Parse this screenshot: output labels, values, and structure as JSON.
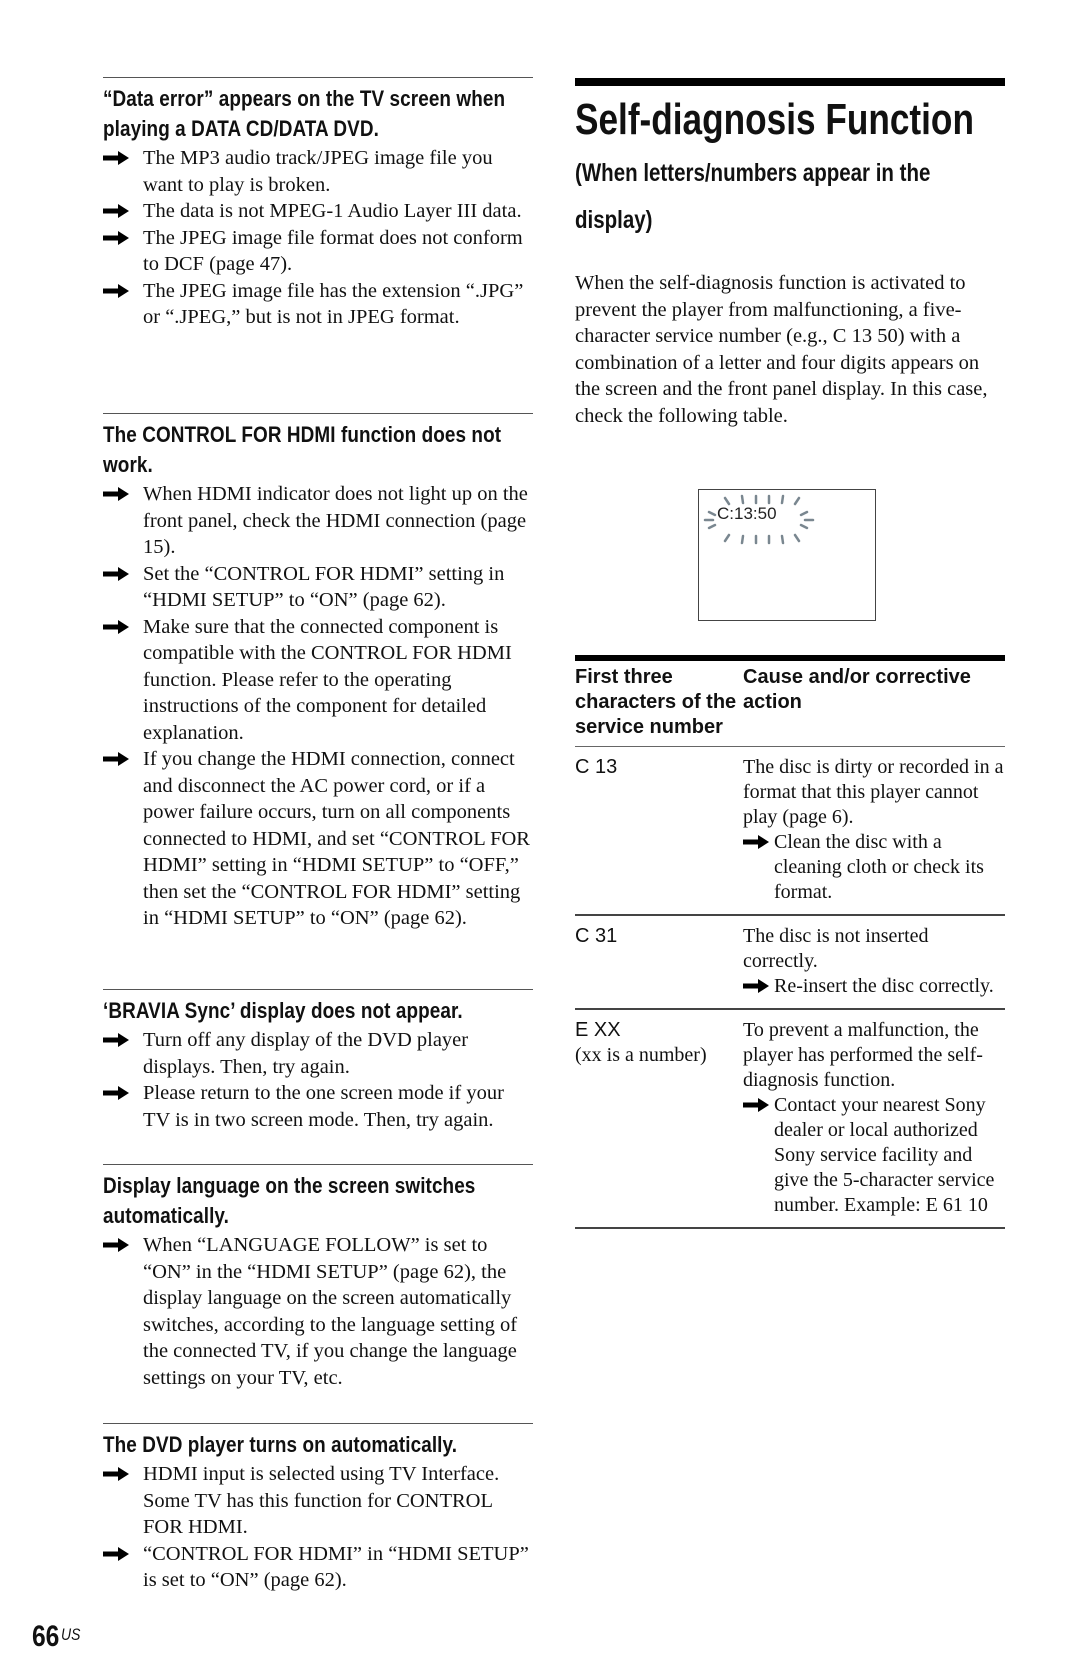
{
  "left_column": {
    "sections": [
      {
        "title": "“Data error” appears on the TV screen when playing a DATA CD/DATA DVD.",
        "bullets": [
          "The MP3 audio track/JPEG image file you want to play is broken.",
          "The data is not MPEG-1 Audio Layer III data.",
          "The JPEG image file format does not conform to DCF (page 47).",
          "The JPEG image file has the extension “.JPG” or “.JPEG,” but is not in JPEG format."
        ]
      },
      {
        "title": "The CONTROL FOR HDMI function does not work.",
        "bullets": [
          "When HDMI indicator does not light up on the front panel, check the HDMI connection (page 15).",
          "Set the “CONTROL FOR HDMI” setting in “HDMI SETUP” to “ON” (page 62).",
          "Make sure that the connected component is compatible with the CONTROL FOR HDMI function. Please refer to the operating instructions of the component for detailed explanation.",
          "If you change the HDMI connection, connect and disconnect the AC power cord, or if a power failure occurs, turn on all components connected to HDMI, and set “CONTROL FOR HDMI” setting in “HDMI SETUP” to “OFF,” then set the “CONTROL FOR HDMI” setting in “HDMI SETUP” to “ON” (page 62)."
        ]
      },
      {
        "title": "‘BRAVIA Sync’ display does not appear.",
        "bullets": [
          "Turn off any display of the DVD player displays. Then, try again.",
          "Please return to the one screen mode if your TV is in two screen mode. Then, try again."
        ]
      },
      {
        "title": "Display language on the screen switches automatically.",
        "bullets": [
          "When “LANGUAGE FOLLOW” is set to “ON” in the “HDMI SETUP” (page 62), the display language on the screen automatically switches, according to the language setting of the connected TV, if you change the language settings on your TV, etc."
        ]
      },
      {
        "title": "The DVD player turns on automatically.",
        "bullets": [
          "HDMI input is selected using TV Interface. Some TV has this function for CONTROL FOR HDMI.",
          "“CONTROL FOR HDMI” in “HDMI SETUP” is set to “ON” (page 62)."
        ]
      }
    ]
  },
  "right_column": {
    "title": "Self-diagnosis Function",
    "subtitle": "(When letters/numbers appear in the display)",
    "intro": "When the self-diagnosis function is activated to prevent the player from malfunctioning, a five-character service number (e.g., C 13 50) with a combination of a letter and four digits appears on the screen and the front panel display. In this case, check the following table.",
    "display_illustration": {
      "text": "C:13:50",
      "icon": "blinking-display-icon"
    },
    "table": {
      "headers": [
        "First three characters of the service number",
        "Cause and/or corrective action"
      ],
      "rows": [
        {
          "code": "C 13",
          "code_note": "",
          "cause": "The disc is dirty or recorded in a format that this player cannot play (page 6).",
          "action": "Clean the disc with a cleaning cloth or check its format."
        },
        {
          "code": "C 31",
          "code_note": "",
          "cause": "The disc is not inserted correctly.",
          "action": "Re-insert the disc correctly."
        },
        {
          "code": "E XX",
          "code_note": "(xx is a number)",
          "cause": "To prevent a malfunction, the player has performed the self-diagnosis function.",
          "action": "Contact your nearest Sony dealer or local authorized Sony service facility and give the 5-character service number. Example: E 61 10"
        }
      ]
    }
  },
  "footer": {
    "page_number": "66",
    "region": "US"
  },
  "colors": {
    "text": "#111111",
    "rule": "#555555",
    "bar": "#000000"
  }
}
